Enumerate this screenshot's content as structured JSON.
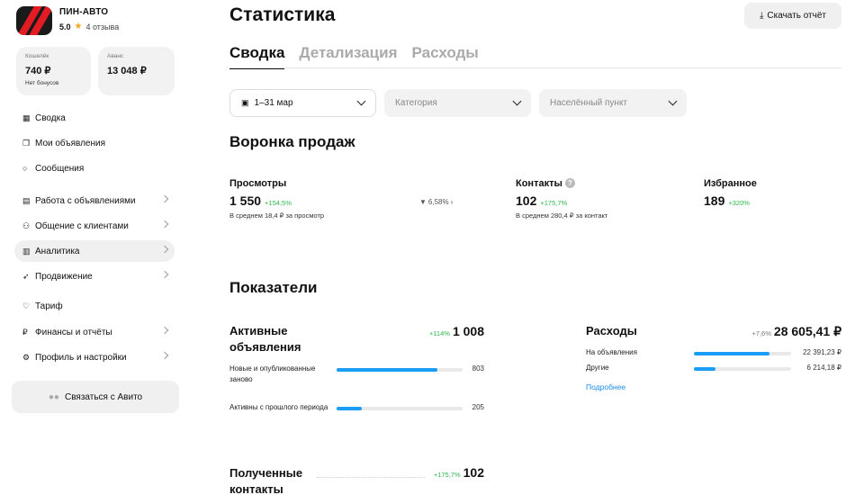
{
  "company": {
    "name": "ПИН-АВТО",
    "rating": "5.0",
    "reviews": "4 отзыва"
  },
  "wallet": {
    "label": "Кошелёк",
    "value": "740 ₽",
    "bonus": "Нет бонусов"
  },
  "advance": {
    "label": "Аванс",
    "value": "13 048 ₽"
  },
  "sidebar": {
    "items": [
      {
        "label": "Сводка",
        "icon": "grid-icon"
      },
      {
        "label": "Мои объявления",
        "icon": "listings-icon"
      },
      {
        "label": "Сообщения",
        "icon": "chat-icon"
      },
      {
        "label": "Работа с объявлениями",
        "icon": "tools-icon"
      },
      {
        "label": "Общение с клиентами",
        "icon": "clients-icon"
      },
      {
        "label": "Аналитика",
        "icon": "chart-icon"
      },
      {
        "label": "Продвижение",
        "icon": "rocket-icon"
      },
      {
        "label": "Тариф",
        "icon": "tariff-icon"
      },
      {
        "label": "Финансы и отчёты",
        "icon": "ruble-icon"
      },
      {
        "label": "Профиль и настройки",
        "icon": "settings-icon"
      }
    ],
    "contact_button": "Связаться с Авито"
  },
  "header": {
    "title": "Статистика",
    "download": "Скачать отчёт"
  },
  "tabs": [
    "Сводка",
    "Детализация",
    "Расходы"
  ],
  "filters": {
    "period": "1–31 мар",
    "category": "Категория",
    "locality": "Населённый пункт"
  },
  "funnel": {
    "title": "Воронка продаж",
    "views": {
      "label": "Просмотры",
      "value": "1 550",
      "delta": "+154,5%",
      "note": "В среднем 18,4 ₽ за просмотр"
    },
    "conversion": "6,58%",
    "contacts": {
      "label": "Контакты",
      "value": "102",
      "delta": "+175,7%",
      "note": "В среднем 280,4 ₽ за контакт"
    },
    "favorites": {
      "label": "Избранное",
      "value": "189",
      "delta": "+320%"
    }
  },
  "indicators": {
    "title": "Показатели",
    "active": {
      "title": "Активные объявления",
      "delta": "+114%",
      "total": "1 008",
      "rows": [
        {
          "label": "Новые и опубликованные заново",
          "value": "803",
          "fraction": 0.8
        },
        {
          "label": "Активны с прошлого периода",
          "value": "205",
          "fraction": 0.2
        }
      ]
    },
    "expenses": {
      "title": "Расходы",
      "delta": "+7,6%",
      "total": "28 605,41 ₽",
      "rows": [
        {
          "label": "На объявления",
          "value": "22 391,23 ₽",
          "fraction": 0.78
        },
        {
          "label": "Другие",
          "value": "6 214,18 ₽",
          "fraction": 0.22
        }
      ],
      "more": "Подробнее"
    },
    "received": {
      "title": "Полученные контакты",
      "delta": "+175,7%",
      "total": "102"
    }
  }
}
